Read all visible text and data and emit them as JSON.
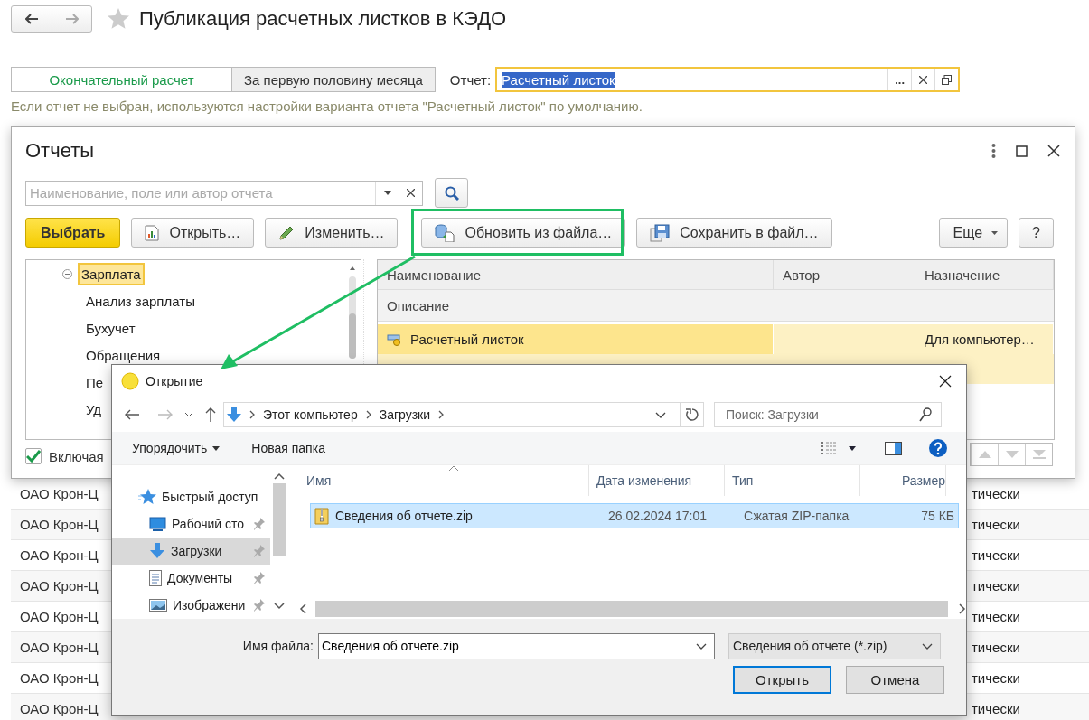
{
  "page": {
    "title": "Публикация расчетных листков в КЭДО",
    "mode_tabs": [
      {
        "label": "Окончательный расчет",
        "selected": true
      },
      {
        "label": "За первую половину месяца",
        "selected": false
      }
    ],
    "report_field": {
      "label": "Отчет:",
      "value": "Расчетный листок",
      "choose_button": "..."
    },
    "hint": "Если отчет не выбран, используются настройки варианта отчета \"Расчетный листок\" по умолчанию.",
    "background_rows": [
      {
        "column_1": "ОАО Крон-Ц",
        "column_2": "тически"
      },
      {
        "column_1": "ОАО Крон-Ц",
        "column_2": "тически"
      },
      {
        "column_1": "ОАО Крон-Ц",
        "column_2": "тически"
      },
      {
        "column_1": "ОАО Крон-Ц",
        "column_2": "тически"
      },
      {
        "column_1": "ОАО Крон-Ц",
        "column_2": "тически"
      },
      {
        "column_1": "ОАО Крон-Ц",
        "column_2": "тически"
      },
      {
        "column_1": "ОАО Крон-Ц",
        "column_2": "тически"
      },
      {
        "column_1": "ОАО Крон-Ц",
        "column_2": "тически"
      }
    ]
  },
  "reports_dialog": {
    "title": "Отчеты",
    "search": {
      "placeholder": "Наименование, поле или автор отчета"
    },
    "buttons": [
      {
        "label": "Выбрать",
        "kind": "default"
      },
      {
        "label": "Открыть…",
        "kind": "report"
      },
      {
        "label": "Изменить…",
        "kind": "edit"
      },
      {
        "label": "Обновить из файла…",
        "kind": "load"
      },
      {
        "label": "Сохранить в файл…",
        "kind": "save"
      }
    ],
    "more_button": "Еще",
    "help_button": "?",
    "tree": [
      {
        "label": "Зарплата",
        "expanded": true,
        "selected": true,
        "children": [
          {
            "label": "Анализ зарплаты",
            "selected": false
          },
          {
            "label": "Бухучет",
            "selected": false
          },
          {
            "label": "Обращения",
            "selected": false
          },
          {
            "label": "Пе",
            "selected": false
          },
          {
            "label": "Уд",
            "selected": false
          }
        ]
      }
    ],
    "include_checkbox": {
      "label": "Включая",
      "checked": true
    },
    "table": {
      "columns": [
        "Наименование",
        "Автор",
        "Назначение"
      ],
      "subheader": "Описание",
      "rows": [
        {
          "name": "Расчетный листок",
          "purpose": "Для компьютер…",
          "selected": true
        }
      ]
    }
  },
  "open_dialog": {
    "title": "Открытие",
    "breadcrumb": [
      "Этот компьютер",
      "Загрузки"
    ],
    "search": {
      "placeholder": "Поиск: Загрузки"
    },
    "toolbar": {
      "organize": "Упорядочить",
      "new_folder": "Новая папка"
    },
    "nav_items": [
      {
        "label": "Быстрый доступ",
        "kind": "star",
        "selected": false
      },
      {
        "label": "Рабочий сто",
        "kind": "desktop",
        "selected": false
      },
      {
        "label": "Загрузки",
        "kind": "downloads",
        "selected": true
      },
      {
        "label": "Документы",
        "kind": "documents",
        "selected": false
      },
      {
        "label": "Изображени",
        "kind": "pictures",
        "selected": false
      }
    ],
    "columns": [
      "Имя",
      "Дата изменения",
      "Тип",
      "Размер"
    ],
    "files": [
      {
        "name": "Сведения об отчете.zip",
        "modified": "26.02.2024 17:01",
        "type": "Сжатая ZIP-папка",
        "size": "75 КБ",
        "selected": true
      }
    ],
    "file_name_label": "Имя файла:",
    "file_name": "Сведения об отчете.zip",
    "filter": "Сведения об отчете (*.zip)",
    "open_button": "Открыть",
    "cancel_button": "Отмена"
  }
}
